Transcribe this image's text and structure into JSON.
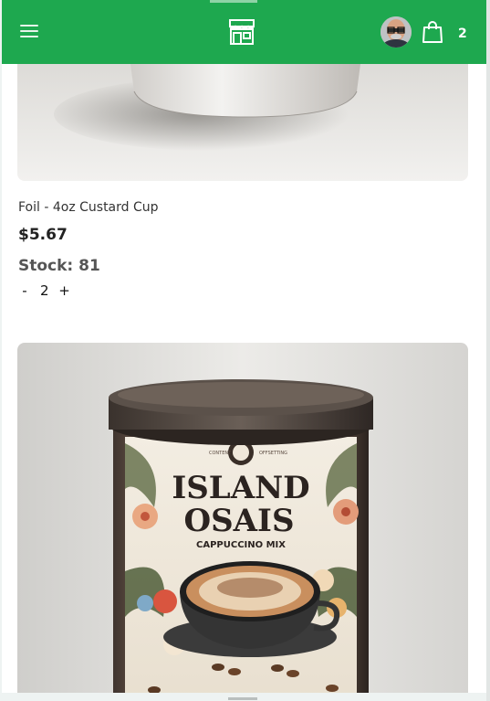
{
  "header": {
    "menu_icon": "hamburger-menu-icon",
    "logo_icon": "store-icon",
    "avatar_icon": "user-avatar",
    "cart_icon": "shopping-bag-icon",
    "cart_count": "2",
    "bar_color": "#1ea84f"
  },
  "products": [
    {
      "name": "Foil - 4oz Custard Cup",
      "price": "$5.67",
      "stock": "Stock: 81",
      "quantity": "2",
      "decrement": "-",
      "increment": "+",
      "image": "custard-cup-photo"
    },
    {
      "image": "island-osais-cappuccino-mix-photo",
      "label_title_1": "ISLAND",
      "label_title_2": "OSAIS",
      "label_subtitle": "CAPPUCCINO MIX"
    }
  ]
}
